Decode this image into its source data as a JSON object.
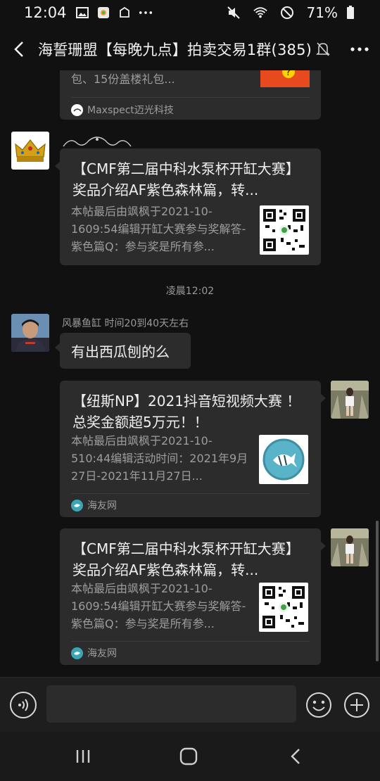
{
  "status_bar": {
    "time": "12:04",
    "battery": "71%"
  },
  "header": {
    "title": "海誓珊盟【每晚九点】拍卖交易1群(385)"
  },
  "messages": {
    "card0": {
      "desc": "包、15份盖楼礼包...",
      "source": "Maxspect迈光科技"
    },
    "card1": {
      "title": "【CMF第二届中科水泵杯开缸大赛】奖品介绍AF紫色森林篇，转...",
      "desc": "本帖最后由飒枫于2021-10-1609:54编辑开缸大赛参与奖解答-紫色篇Q：参与奖是所有参..."
    },
    "timestamp": "凌晨12:02",
    "text_msg": {
      "sender": "风暴鱼缸 时间20到40天左右",
      "text": "有出西瓜刨的么"
    },
    "card2": {
      "title": "【纽斯NP】2021抖音短视频大赛 ！总奖金额超5万元！！",
      "desc": "本帖最后由飒枫于2021-10-510:44编辑活动时间：2021年9月27日-2021年11月27日...",
      "source": "海友网"
    },
    "card3": {
      "title": "【CMF第二届中科水泵杯开缸大赛】奖品介绍AF紫色森林篇，转...",
      "desc": "本帖最后由飒枫于2021-10-1609:54编辑开缸大赛参与奖解答-紫色篇Q：参与奖是所有参...",
      "source": "海友网"
    }
  },
  "input": {
    "value": "",
    "placeholder": ""
  },
  "colors": {
    "background": "#111111",
    "bubble": "#2c2c2c",
    "text": "#eeeeee",
    "muted": "#9d9d9d",
    "accent_green": "#1aad19"
  }
}
